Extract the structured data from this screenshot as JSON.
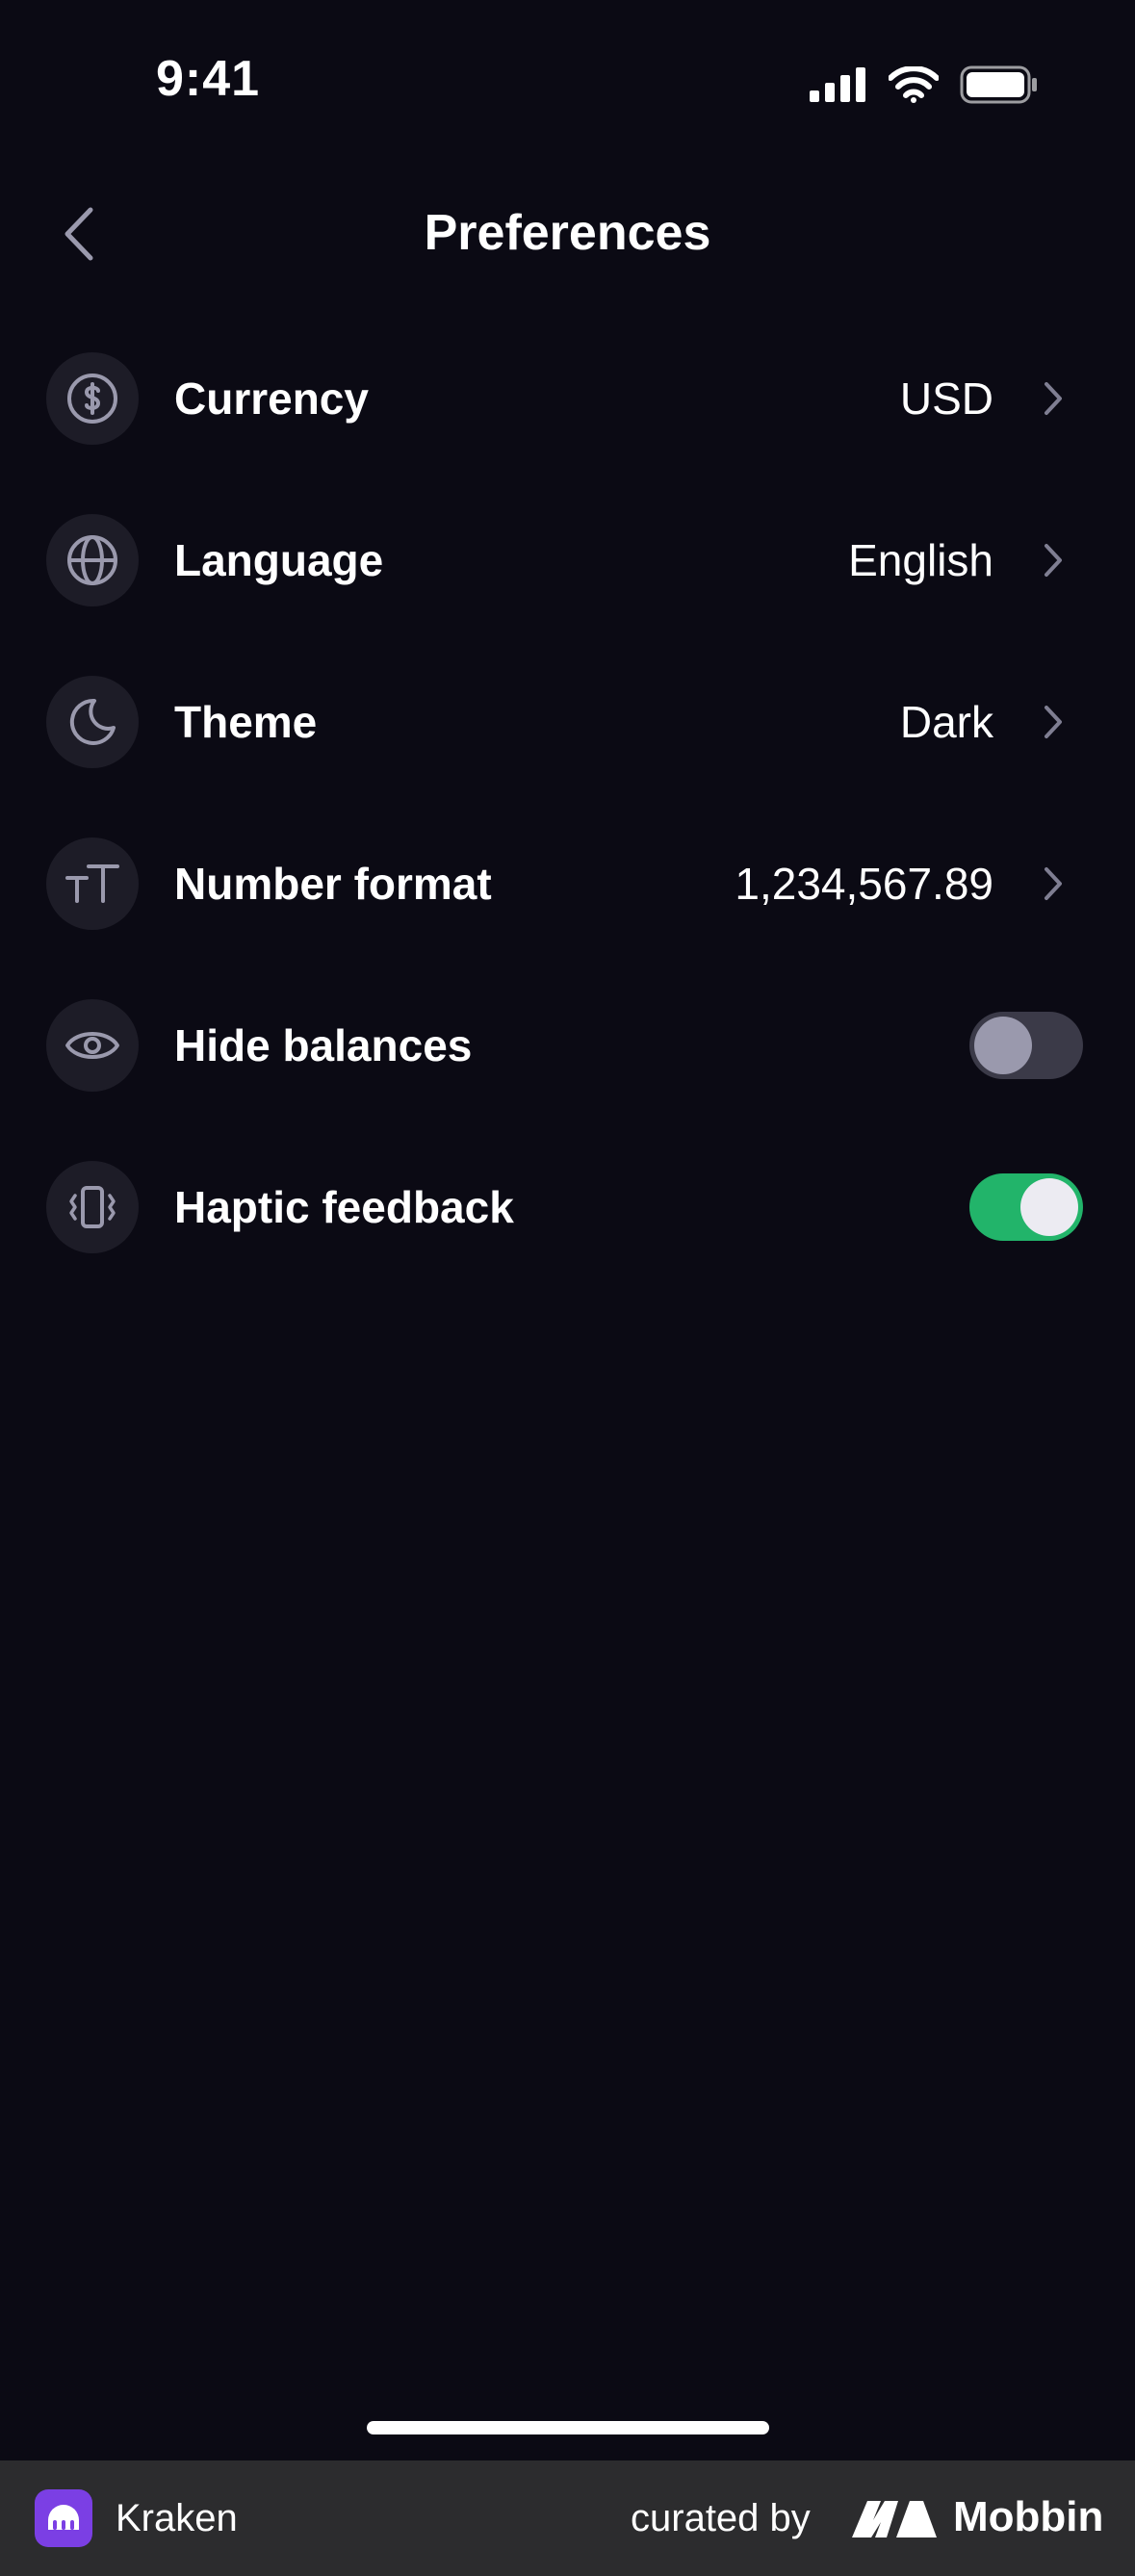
{
  "status_bar": {
    "time": "9:41"
  },
  "header": {
    "title": "Preferences",
    "back_icon": "chevron-left-icon"
  },
  "settings": [
    {
      "label": "Currency",
      "value": "USD",
      "icon": "dollar-circle-icon",
      "kind": "link"
    },
    {
      "label": "Language",
      "value": "English",
      "icon": "globe-icon",
      "kind": "link"
    },
    {
      "label": "Theme",
      "value": "Dark",
      "icon": "moon-icon",
      "kind": "link"
    },
    {
      "label": "Number format",
      "value": "1,234,567.89",
      "icon": "text-size-icon",
      "kind": "link"
    },
    {
      "label": "Hide balances",
      "icon": "eye-icon",
      "kind": "toggle",
      "enabled": false
    },
    {
      "label": "Haptic feedback",
      "icon": "phone-vibrate-icon",
      "kind": "toggle",
      "enabled": true
    }
  ],
  "footer": {
    "app_name": "Kraken",
    "curated_by": "curated by",
    "brand": "Mobbin"
  },
  "colors": {
    "background": "#0b0a14",
    "icon_bg": "#1d1c27",
    "toggle_on": "#22b46a",
    "toggle_off": "#3b3a48",
    "kraken_purple": "#7b3fe4",
    "footer_bg": "#2c2c2e"
  }
}
